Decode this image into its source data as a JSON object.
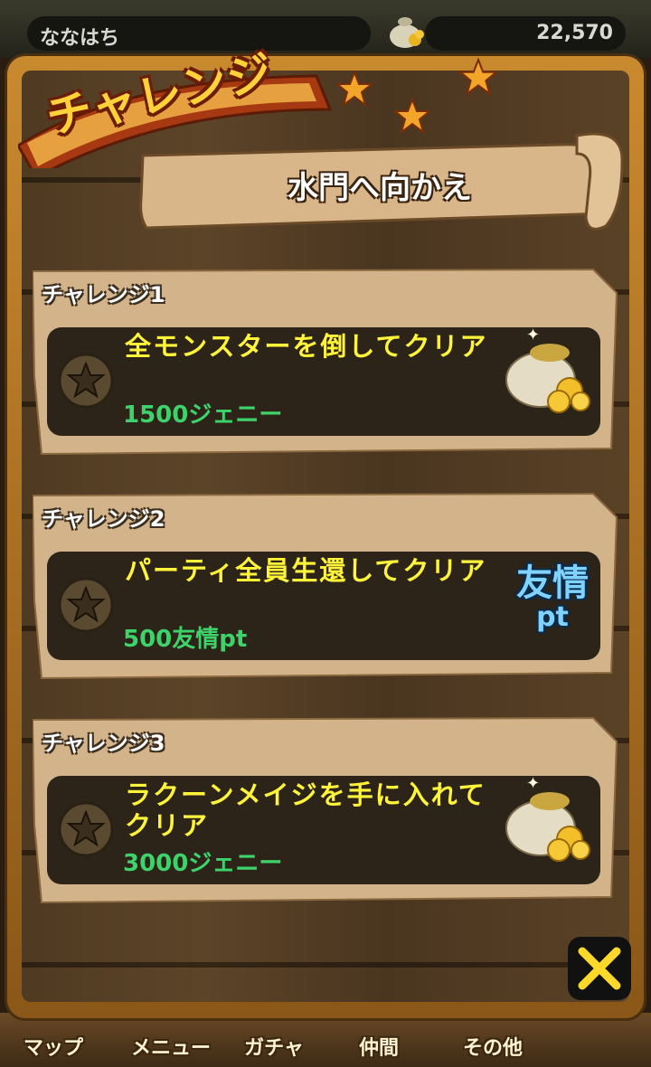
{
  "topbar": {
    "player_name": "ななはち",
    "money": "22,570",
    "money_icon": "money-bag-icon"
  },
  "panel": {
    "title": "チャレンジ",
    "stage_name": "水門へ向かえ"
  },
  "challenges": [
    {
      "label": "チャレンジ1",
      "condition": "全モンスターを倒してクリア",
      "reward": "1500ジェニー",
      "reward_icon": "money-bag-icon"
    },
    {
      "label": "チャレンジ2",
      "condition": "パーティ全員生還してクリア",
      "reward": "500友情pt",
      "reward_icon": "friendship-pt-icon",
      "reward_icon_text_top": "友情",
      "reward_icon_text_bottom": "pt"
    },
    {
      "label": "チャレンジ3",
      "condition": "ラクーンメイジを手に入れてクリア",
      "reward": "3000ジェニー",
      "reward_icon": "money-bag-icon"
    }
  ],
  "bottom_nav": [
    {
      "label": "マップ"
    },
    {
      "label": "メニュー"
    },
    {
      "label": "ガチャ"
    },
    {
      "label": "仲間"
    },
    {
      "label": "その他"
    }
  ],
  "colors": {
    "challenge_text": "#fff43a",
    "reward_text": "#3ed36a",
    "panel_frame": "#c98a2e"
  }
}
